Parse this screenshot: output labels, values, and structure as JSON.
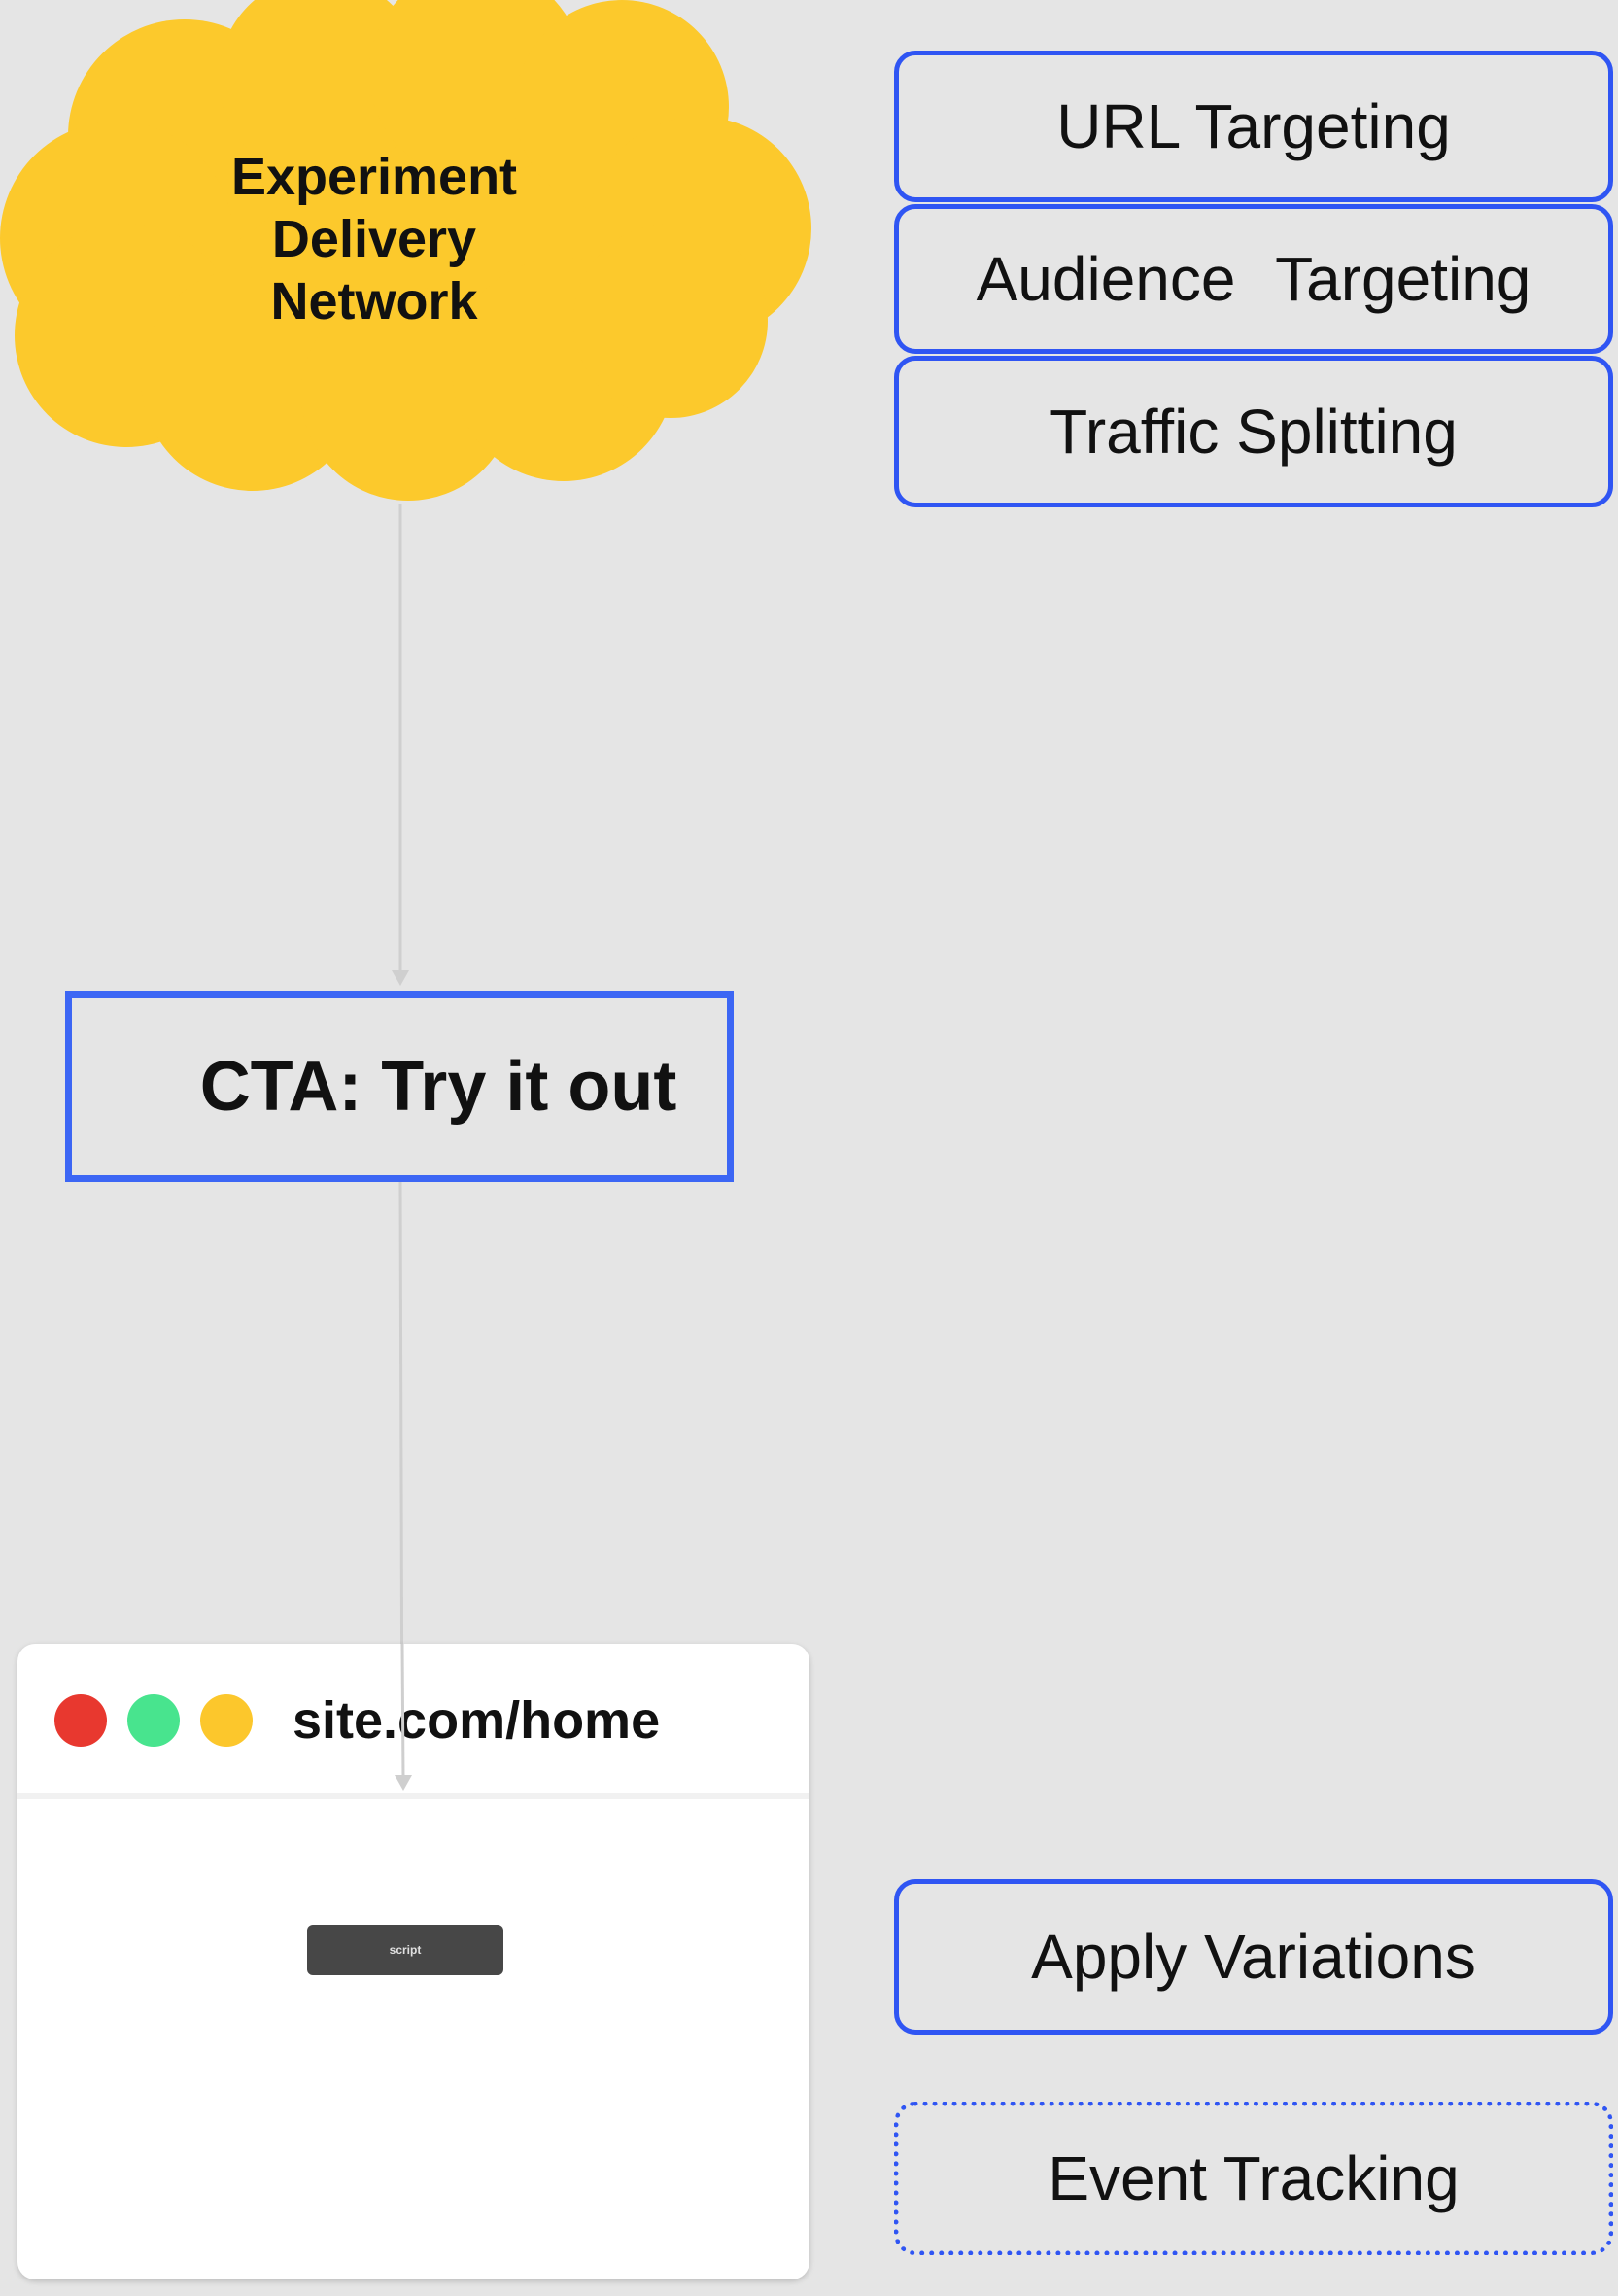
{
  "cloud": {
    "line1": "Experiment",
    "line2": "Delivery",
    "line3": "Network",
    "color": "#fcc92c"
  },
  "targeting_boxes": {
    "url": "URL Targeting",
    "audience": "Audience Targeting",
    "traffic": "Traffic Splitting"
  },
  "cta": {
    "label": "CTA: Try it out"
  },
  "browser": {
    "url": "site.com/home",
    "script_label": "script",
    "dot_colors": [
      "#e8382f",
      "#48e48e",
      "#fcc72c"
    ]
  },
  "actions": {
    "apply": "Apply Variations",
    "event": "Event Tracking"
  },
  "colors": {
    "background": "#e5e5e5",
    "box_border": "#2f55f3",
    "connector": "#cfcfcf"
  }
}
